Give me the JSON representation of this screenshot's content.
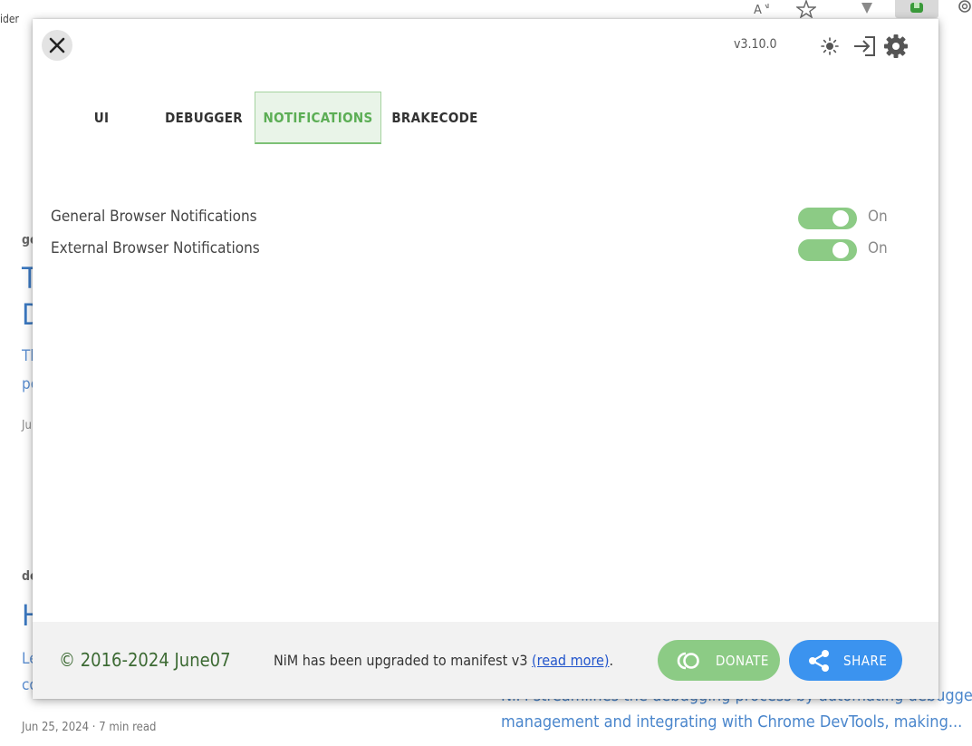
{
  "background": {
    "top_fragment": "ider",
    "categories": [
      "go",
      "de"
    ],
    "headline_fragments": [
      "T",
      "D",
      "H"
    ],
    "excerpt_fragments": [
      "Th",
      "pe",
      "Le",
      "co"
    ],
    "date_fragment": "Ju",
    "meta": "Jun 25, 2024 · 7 min read",
    "article_excerpt": [
      "NiM streamlines the debugging process by automating debugger",
      "management and integrating with Chrome DevTools, making..."
    ]
  },
  "browser_toolbar": {
    "icons": [
      "read-aloud-icon",
      "favorite-star-icon",
      "extension-icon",
      "nim-extension-icon",
      "settings-icon"
    ]
  },
  "header": {
    "version": "v3.10.0",
    "icons": [
      "theme-sun-icon",
      "sign-in-icon",
      "gear-icon"
    ]
  },
  "tabs": [
    {
      "label": "UI",
      "active": false
    },
    {
      "label": "DEBUGGER",
      "active": false
    },
    {
      "label": "NOTIFICATIONS",
      "active": true
    },
    {
      "label": "BRAKECODE",
      "active": false
    }
  ],
  "settings": [
    {
      "label": "General Browser Notifications",
      "state": "On",
      "enabled": true
    },
    {
      "label": "External Browser Notifications",
      "state": "On",
      "enabled": true
    }
  ],
  "footer": {
    "copyright": "© 2016-2024 June07",
    "notice_prefix": "NiM has been upgraded to manifest v3 ",
    "notice_link": "(read more)",
    "notice_suffix": ".",
    "donate_label": "DONATE",
    "share_label": "SHARE"
  },
  "colors": {
    "accent_green": "#8ccb85",
    "active_tab_text": "#5cae55",
    "share_blue": "#3b93ef",
    "copyright_green": "#3c6a33"
  }
}
